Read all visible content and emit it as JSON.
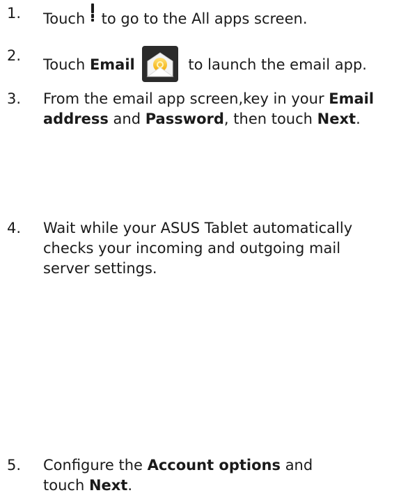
{
  "steps": [
    {
      "num": "1.",
      "pre": "Touch",
      "post": " to go to the All apps screen."
    },
    {
      "num": "2.",
      "pre": "Touch ",
      "bold1": "Email",
      "post": " to launch the email app."
    },
    {
      "num": "3.",
      "pre": "From the email app screen,key in your ",
      "bold1": "Email address",
      "mid": " and ",
      "bold2": "Password",
      "mid2": ", then  touch ",
      "bold3": "Next",
      "post": "."
    },
    {
      "num": "4.",
      "text": "Wait while your ASUS Tablet automatically checks your incoming and outgoing mail server settings."
    },
    {
      "num": "5.",
      "pre": "Configure the ",
      "bold1": "Account options",
      "mid": " and touch ",
      "bold2": "Next",
      "post": "."
    }
  ],
  "icons": {
    "apps": "all-apps-grid-icon",
    "email": "email-app-icon"
  }
}
